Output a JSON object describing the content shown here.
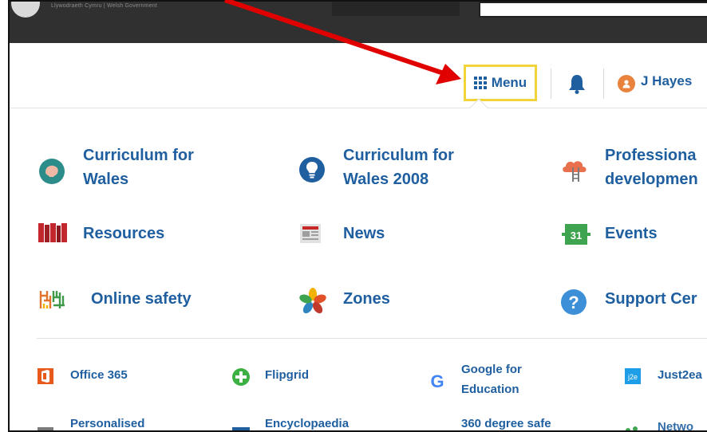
{
  "topbar": {
    "tagline": "Llywodraeth Cymru | Welsh Government"
  },
  "header": {
    "menu_label": "Menu",
    "user_initial": "●",
    "user_name": "J Hayes"
  },
  "menu": {
    "big_items": [
      {
        "line1": "Curriculum for",
        "line2": "Wales",
        "icon": "brain-icon"
      },
      {
        "line1": "Curriculum for",
        "line2": "Wales 2008",
        "icon": "lightbulb-icon"
      },
      {
        "line1": "Professiona",
        "line2": "developmen",
        "icon": "cloud-ladder-icon"
      },
      {
        "line1": "Resources",
        "icon": "books-icon"
      },
      {
        "line1": "News",
        "icon": "newspaper-icon"
      },
      {
        "line1": "Events",
        "icon": "calendar-icon",
        "calendar_day": "31"
      },
      {
        "line1": "Online safety",
        "icon": "maze-icon"
      },
      {
        "line1": "Zones",
        "icon": "pinwheel-icon"
      },
      {
        "line1": "Support Cer",
        "icon": "help-icon"
      }
    ],
    "small_items": [
      {
        "line1": "Office 365",
        "icon": "office-icon"
      },
      {
        "line1": "Flipgrid",
        "icon": "flipgrid-icon"
      },
      {
        "line1": "Google for",
        "line2": "Education",
        "icon": "google-icon",
        "icon_text": "G"
      },
      {
        "line1": "Just2ea",
        "icon": "j2e-icon",
        "icon_text": "j2e"
      },
      {
        "line1": "Personalised",
        "icon": "personalised-icon"
      },
      {
        "line1": "Encyclopaedia",
        "icon": "encyclopaedia-icon"
      },
      {
        "line1": "360 degree safe",
        "icon": "safe-360-icon"
      },
      {
        "line1": "Netwo",
        "icon": "network-icon"
      }
    ]
  },
  "colors": {
    "link": "#1f5fa0",
    "menu_highlight": "#f2d33a",
    "annotation_arrow": "#e00000"
  }
}
